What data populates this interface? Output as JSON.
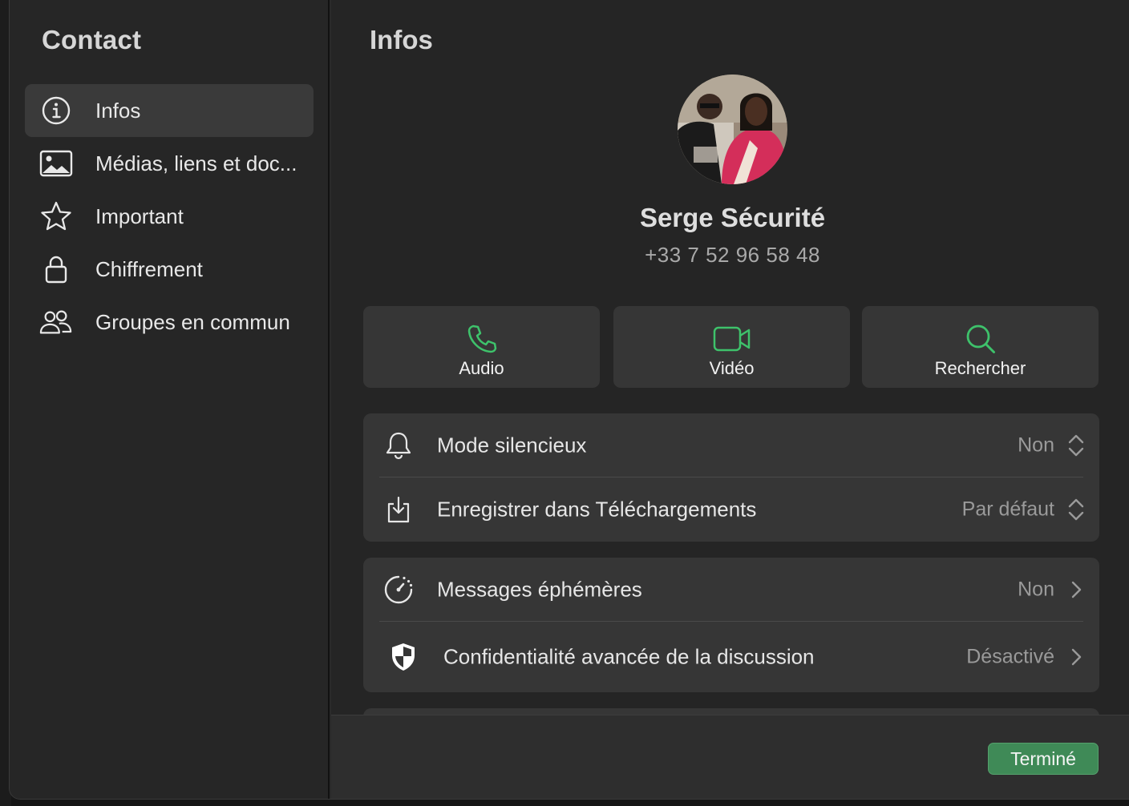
{
  "sidebar": {
    "title": "Contact",
    "items": [
      {
        "label": "Infos",
        "icon": "info-icon",
        "active": true
      },
      {
        "label": "Médias, liens et doc...",
        "icon": "image-icon",
        "active": false
      },
      {
        "label": "Important",
        "icon": "star-icon",
        "active": false
      },
      {
        "label": "Chiffrement",
        "icon": "lock-icon",
        "active": false
      },
      {
        "label": "Groupes en commun",
        "icon": "people-icon",
        "active": false
      }
    ]
  },
  "main": {
    "title": "Infos",
    "contact": {
      "name": "Serge Sécurité",
      "phone": "+33 7 52 96 58 48"
    },
    "actions": [
      {
        "label": "Audio",
        "icon": "phone-icon"
      },
      {
        "label": "Vidéo",
        "icon": "video-camera-icon"
      },
      {
        "label": "Rechercher",
        "icon": "search-icon"
      }
    ],
    "settings_group_1": [
      {
        "label": "Mode silencieux",
        "value": "Non",
        "icon": "bell-icon",
        "control": "stepper"
      },
      {
        "label": "Enregistrer dans Téléchargements",
        "value": "Par défaut",
        "icon": "download-icon",
        "control": "stepper"
      }
    ],
    "settings_group_2": [
      {
        "label": "Messages éphémères",
        "value": "Non",
        "icon": "timer-icon",
        "control": "chevron"
      },
      {
        "label": "Confidentialité avancée de la discussion",
        "value": "Désactivé",
        "icon": "shield-icon",
        "control": "chevron"
      }
    ]
  },
  "footer": {
    "done_label": "Terminé"
  },
  "colors": {
    "accent_green": "#3f8a57",
    "icon_green": "#3ec26b",
    "background": "#252525",
    "card": "#363636"
  }
}
